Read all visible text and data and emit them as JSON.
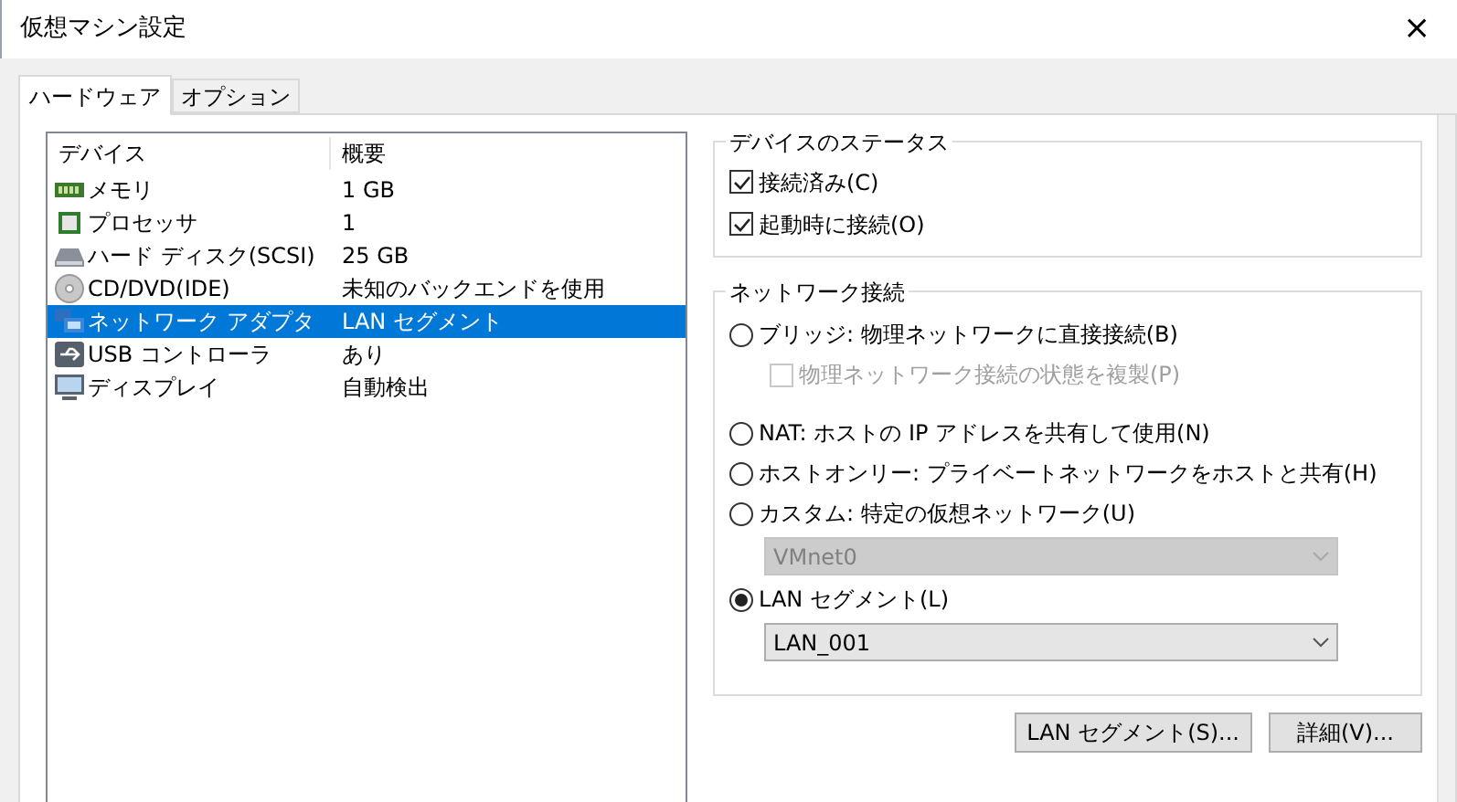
{
  "window": {
    "title": "仮想マシン設定",
    "close": "×"
  },
  "tabs": [
    {
      "label": "ハードウェア",
      "selected": true
    },
    {
      "label": "オプション",
      "selected": false
    }
  ],
  "device_list": {
    "columns": [
      "デバイス",
      "概要"
    ],
    "rows": [
      {
        "kind": "memory",
        "device": "メモリ",
        "summary": "1 GB",
        "selected": false
      },
      {
        "kind": "processor",
        "device": "プロセッサ",
        "summary": "1",
        "selected": false
      },
      {
        "kind": "disk",
        "device": "ハード ディスク(SCSI)",
        "summary": "25 GB",
        "selected": false
      },
      {
        "kind": "cd",
        "device": "CD/DVD(IDE)",
        "summary": "未知のバックエンドを使用",
        "selected": false
      },
      {
        "kind": "network",
        "device": "ネットワーク アダプタ",
        "summary": "LAN セグメント",
        "selected": true
      },
      {
        "kind": "usb",
        "device": "USB コントローラ",
        "summary": "あり",
        "selected": false
      },
      {
        "kind": "display",
        "device": "ディスプレイ",
        "summary": "自動検出",
        "selected": false
      }
    ]
  },
  "device_status": {
    "title": "デバイスのステータス",
    "checkboxes": [
      {
        "label": "接続済み(C)",
        "checked": true
      },
      {
        "label": "起動時に接続(O)",
        "checked": true
      }
    ]
  },
  "network_connection": {
    "title": "ネットワーク接続",
    "items": [
      {
        "kind": "radio",
        "label": "ブリッジ: 物理ネットワークに直接接続(B)",
        "selected": false
      },
      {
        "kind": "checkbox",
        "label": "物理ネットワーク接続の状態を複製(P)",
        "checked": false,
        "disabled": true
      },
      {
        "kind": "radio",
        "label": "NAT: ホストの IP アドレスを共有して使用(N)",
        "selected": false
      },
      {
        "kind": "radio",
        "label": "ホストオンリー: プライベートネットワークをホストと共有(H)",
        "selected": false
      },
      {
        "kind": "radio",
        "label": "カスタム: 特定の仮想ネットワーク(U)",
        "selected": false
      },
      {
        "kind": "dropdown",
        "value": "VMnet0",
        "disabled": true
      },
      {
        "kind": "radio",
        "label": "LAN セグメント(L)",
        "selected": true
      },
      {
        "kind": "dropdown",
        "value": "LAN_001",
        "disabled": false
      }
    ]
  },
  "buttons": [
    "LAN セグメント(S)...",
    "詳細(V)..."
  ]
}
